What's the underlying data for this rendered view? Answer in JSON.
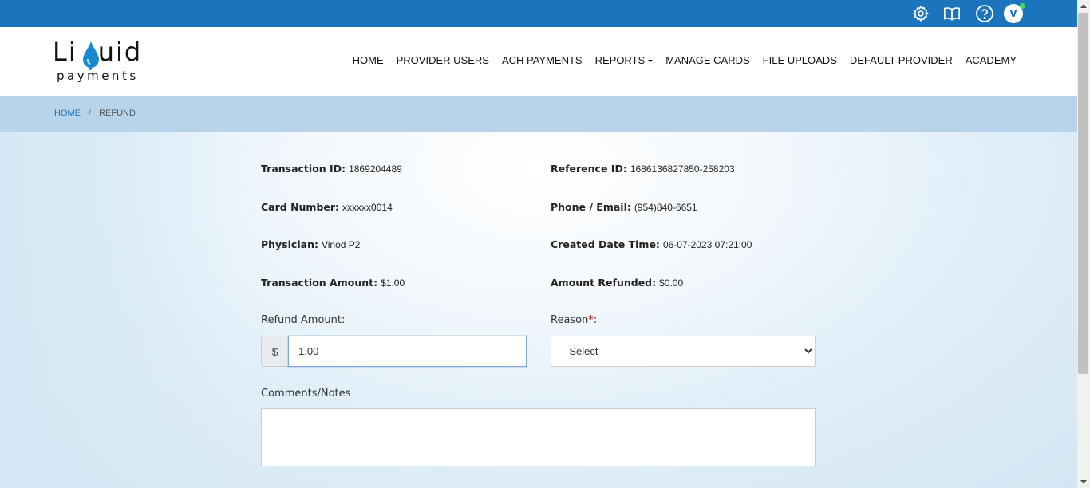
{
  "topbar": {
    "avatar_initial": "V",
    "icons": [
      "gear-icon",
      "book-icon",
      "help-icon"
    ]
  },
  "logo": {
    "word_left": "Li",
    "word_right": "uid",
    "sub": "payments"
  },
  "nav": {
    "items": [
      "HOME",
      "PROVIDER USERS",
      "ACH PAYMENTS",
      "REPORTS",
      "MANAGE CARDS",
      "FILE UPLOADS",
      "DEFAULT PROVIDER",
      "ACADEMY"
    ]
  },
  "breadcrumb": {
    "home": "HOME",
    "separator": "/",
    "current": "REFUND"
  },
  "details": {
    "transaction_id_label": "Transaction ID:",
    "transaction_id": "1869204489",
    "reference_id_label": "Reference ID:",
    "reference_id": "1686136827850-258203",
    "card_number_label": "Card Number:",
    "card_number": "xxxxxx0014",
    "phone_label": "Phone / Email:",
    "phone": "(954)840-6651",
    "physician_label": "Physician:",
    "physician": "Vinod P2",
    "created_label": "Created Date Time:",
    "created": "06-07-2023 07:21:00",
    "txn_amount_label": "Transaction Amount:",
    "txn_amount": "$1.00",
    "refunded_label": "Amount Refunded:",
    "refunded": "$0.00"
  },
  "form": {
    "refund_amount_label": "Refund Amount:",
    "currency_symbol": "$",
    "refund_amount_value": "1.00",
    "reason_label": "Reason",
    "reason_required": "*",
    "reason_colon": ":",
    "reason_selected": "-Select-",
    "notes_label": "Comments/Notes",
    "notes_value": ""
  },
  "colors": {
    "topbar": "#1c75bc",
    "breadcrumb_bg": "#b7d4ea",
    "link": "#1c75bc"
  }
}
